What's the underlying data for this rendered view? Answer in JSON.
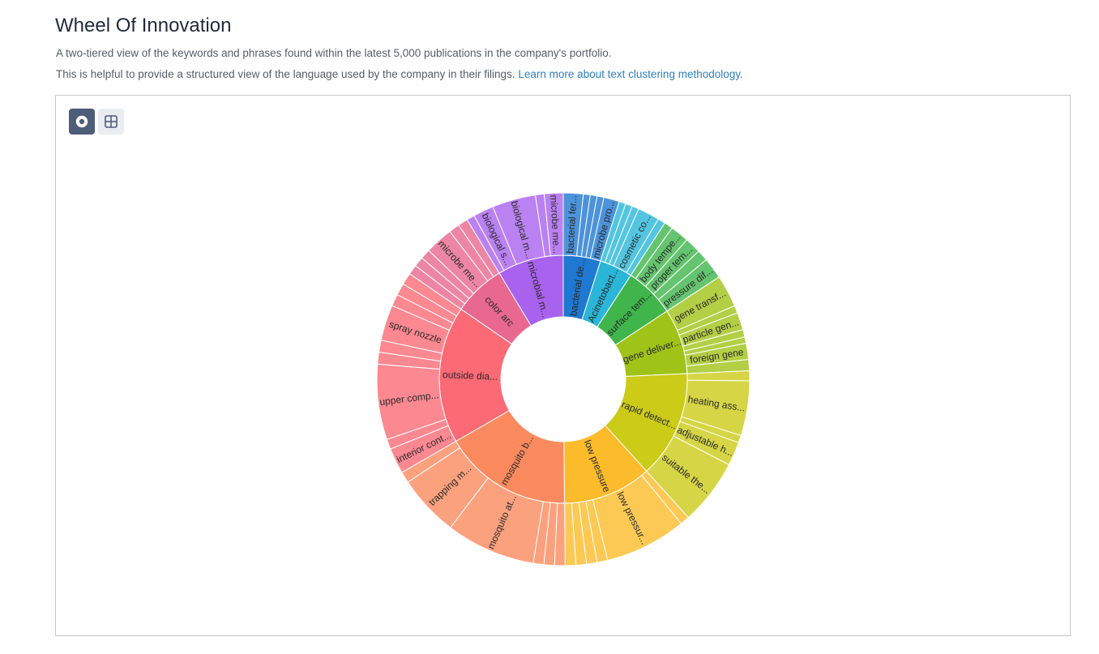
{
  "header": {
    "title": "Wheel Of Innovation",
    "description_1": "A two-tiered view of the keywords and phrases found within the latest 5,000 publications in the company's portfolio.",
    "description_2": "This is helpful to provide a structured view of the language used by the company in their filings.",
    "learn_more_link": "Learn more about text clustering methodology."
  },
  "view_toggle": {
    "options": [
      {
        "name": "sunburst-view",
        "icon": "target-icon",
        "active": true
      },
      {
        "name": "treemap-view",
        "icon": "grid-icon",
        "active": false
      }
    ]
  },
  "chart_data": {
    "type": "sunburst",
    "title": "",
    "levels": 2,
    "center": "empty",
    "clusters": [
      {
        "label": "bacterial de...",
        "color": "#1f78d1",
        "size": 4.5,
        "children": [
          {
            "label": "bacterial fer...",
            "size": 1.6
          },
          {
            "label": "",
            "size": 0.55
          },
          {
            "label": "",
            "size": 0.55
          },
          {
            "label": "",
            "size": 0.55
          },
          {
            "label": "microbe pro...",
            "size": 1.25
          }
        ]
      },
      {
        "label": "Acinetobact...",
        "color": "#29b6d8",
        "size": 4.0,
        "children": [
          {
            "label": "",
            "size": 0.55
          },
          {
            "label": "",
            "size": 0.55
          },
          {
            "label": "",
            "size": 0.55
          },
          {
            "label": "cosmetic co...",
            "size": 1.75
          },
          {
            "label": "",
            "size": 0.6
          }
        ]
      },
      {
        "label": "surface tem...",
        "color": "#3fb54b",
        "size": 6.1,
        "children": [
          {
            "label": "",
            "size": 0.7
          },
          {
            "label": "body tempe...",
            "size": 1.5
          },
          {
            "label": "proper tem...",
            "size": 1.3
          },
          {
            "label": "",
            "size": 0.9
          },
          {
            "label": "pressure dif...",
            "size": 1.7
          }
        ]
      },
      {
        "label": "gene deliver...",
        "color": "#9fc317",
        "size": 7.9,
        "children": [
          {
            "label": "gene transf...",
            "size": 2.6
          },
          {
            "label": "",
            "size": 0.6
          },
          {
            "label": "particle gen...",
            "size": 1.4
          },
          {
            "label": "",
            "size": 0.6
          },
          {
            "label": "",
            "size": 0.5
          },
          {
            "label": "foreign gene",
            "size": 1.3
          },
          {
            "label": "",
            "size": 0.9
          }
        ]
      },
      {
        "label": "rapid detect...",
        "color": "#cbcb18",
        "size": 13.0,
        "children": [
          {
            "label": "",
            "size": 0.8
          },
          {
            "label": "heating ass...",
            "size": 4.4
          },
          {
            "label": "",
            "size": 0.6
          },
          {
            "label": "adjustable h...",
            "size": 1.9
          },
          {
            "label": "suitable the...",
            "size": 5.3
          }
        ]
      },
      {
        "label": "low pressure",
        "color": "#fbbb2a",
        "size": 10.7,
        "children": [
          {
            "label": "",
            "size": 0.75
          },
          {
            "label": "low pressur...",
            "size": 6.55
          },
          {
            "label": "",
            "size": 0.85
          },
          {
            "label": "",
            "size": 0.85
          },
          {
            "label": "",
            "size": 0.85
          },
          {
            "label": "",
            "size": 0.85
          }
        ]
      },
      {
        "label": "mosquito b...",
        "color": "#fb8a5e",
        "size": 15.6,
        "children": [
          {
            "label": "",
            "size": 0.85
          },
          {
            "label": "",
            "size": 0.85
          },
          {
            "label": "",
            "size": 0.85
          },
          {
            "label": "mosquito at...",
            "size": 7.2
          },
          {
            "label": "trapping m...",
            "size": 4.95
          },
          {
            "label": "",
            "size": 0.9
          }
        ]
      },
      {
        "label": "outside dia...",
        "color": "#fb6a75",
        "size": 16.6,
        "children": [
          {
            "label": "interior cont...",
            "size": 1.4
          },
          {
            "label": "",
            "size": 0.55
          },
          {
            "label": "upper comp...",
            "size": 4.1
          },
          {
            "label": "",
            "size": 0.65
          },
          {
            "label": "",
            "size": 0.65
          },
          {
            "label": "spray nozzle",
            "size": 1.95
          },
          {
            "label": "",
            "size": 0.65
          },
          {
            "label": "",
            "size": 0.65
          },
          {
            "label": "",
            "size": 0.65
          }
        ]
      },
      {
        "label": "color arc",
        "color": "#e9688f",
        "size": 6.3,
        "children": [
          {
            "label": "",
            "size": 0.6
          },
          {
            "label": "",
            "size": 0.6
          },
          {
            "label": "",
            "size": 0.6
          },
          {
            "label": "microbe me...",
            "size": 1.7
          },
          {
            "label": "",
            "size": 0.65
          },
          {
            "label": "",
            "size": 0.6
          }
        ]
      },
      {
        "label": "microbial m...",
        "color": "#a862ee",
        "size": 8.0,
        "children": [
          {
            "label": "",
            "size": 0.55
          },
          {
            "label": "biological s...",
            "size": 1.4
          },
          {
            "label": "biological m...",
            "size": 3.0
          },
          {
            "label": "",
            "size": 0.6
          },
          {
            "label": "microbe me...",
            "size": 1.3
          }
        ]
      }
    ]
  }
}
